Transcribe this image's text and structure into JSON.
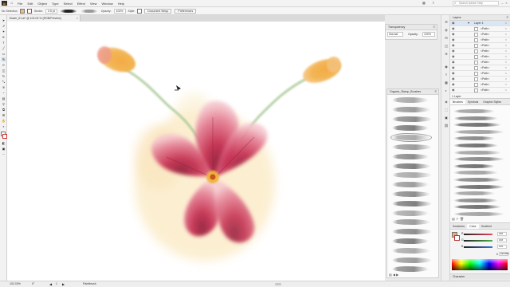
{
  "app": {
    "logo_text": "Ai",
    "menu": [
      "File",
      "Edit",
      "Object",
      "Type",
      "Select",
      "Effect",
      "View",
      "Window",
      "Help"
    ],
    "search_placeholder": "Search Adobe Help"
  },
  "control_bar": {
    "selection_label": "No Selection",
    "stroke_label": "Stroke:",
    "stroke_value": "0.5 pt",
    "opacity_label": "Opacity:",
    "opacity_value": "100%",
    "style_label": "Style:",
    "doc_setup_button": "Document Setup",
    "preferences_button": "Preferences"
  },
  "document_tab": {
    "title": "flower_01.ai* @ 102.03 % (RGB/Preview)"
  },
  "transparency_panel": {
    "title": "Transparency",
    "blend_mode": "Normal",
    "opacity_label": "Opacity:",
    "opacity_value": "100%"
  },
  "brush_library": {
    "title": "Organic_Stamp_Brushes",
    "stroke_count": 19
  },
  "layers_panel": {
    "title": "Layers",
    "main_layer": "Layer 1",
    "sublayers": [
      "<Path>",
      "<Path>",
      "<Path>",
      "<Path>",
      "<Path>",
      "<Path>",
      "<Path>",
      "<Path>",
      "<Path>",
      "<Path>",
      "<Path>",
      "<Path>"
    ],
    "footer": "1 Layer"
  },
  "brushes_panel": {
    "tabs": [
      "Brushes",
      "Symbols",
      "Graphic Styles"
    ],
    "active_tab": "Brushes"
  },
  "color_panel": {
    "tabs": [
      "Swatches",
      "Color",
      "Gradient"
    ],
    "active_tab": "Color",
    "channels": [
      {
        "label": "R",
        "value": "238",
        "color": "#e84a5f"
      },
      {
        "label": "G",
        "value": "168",
        "color": "#4caf50"
      },
      {
        "label": "B",
        "value": "129",
        "color": "#3f6fd8"
      }
    ],
    "hex_label": "#",
    "hex_value": "EEA881",
    "fill_color": "#eea881",
    "footer_tab": "Character"
  },
  "status_bar": {
    "zoom": "102.03%",
    "rotation": "0°",
    "artboard": "1",
    "tool": "Paintbrush"
  },
  "colors": {
    "petal_crimson": "#c42a4e",
    "petal_pink": "#e98aa0",
    "anther_orange": "#f2a441",
    "stem_green": "#a8c98f",
    "wash_yellow": "#f7dfa8",
    "center_gold": "#f0b23a"
  }
}
